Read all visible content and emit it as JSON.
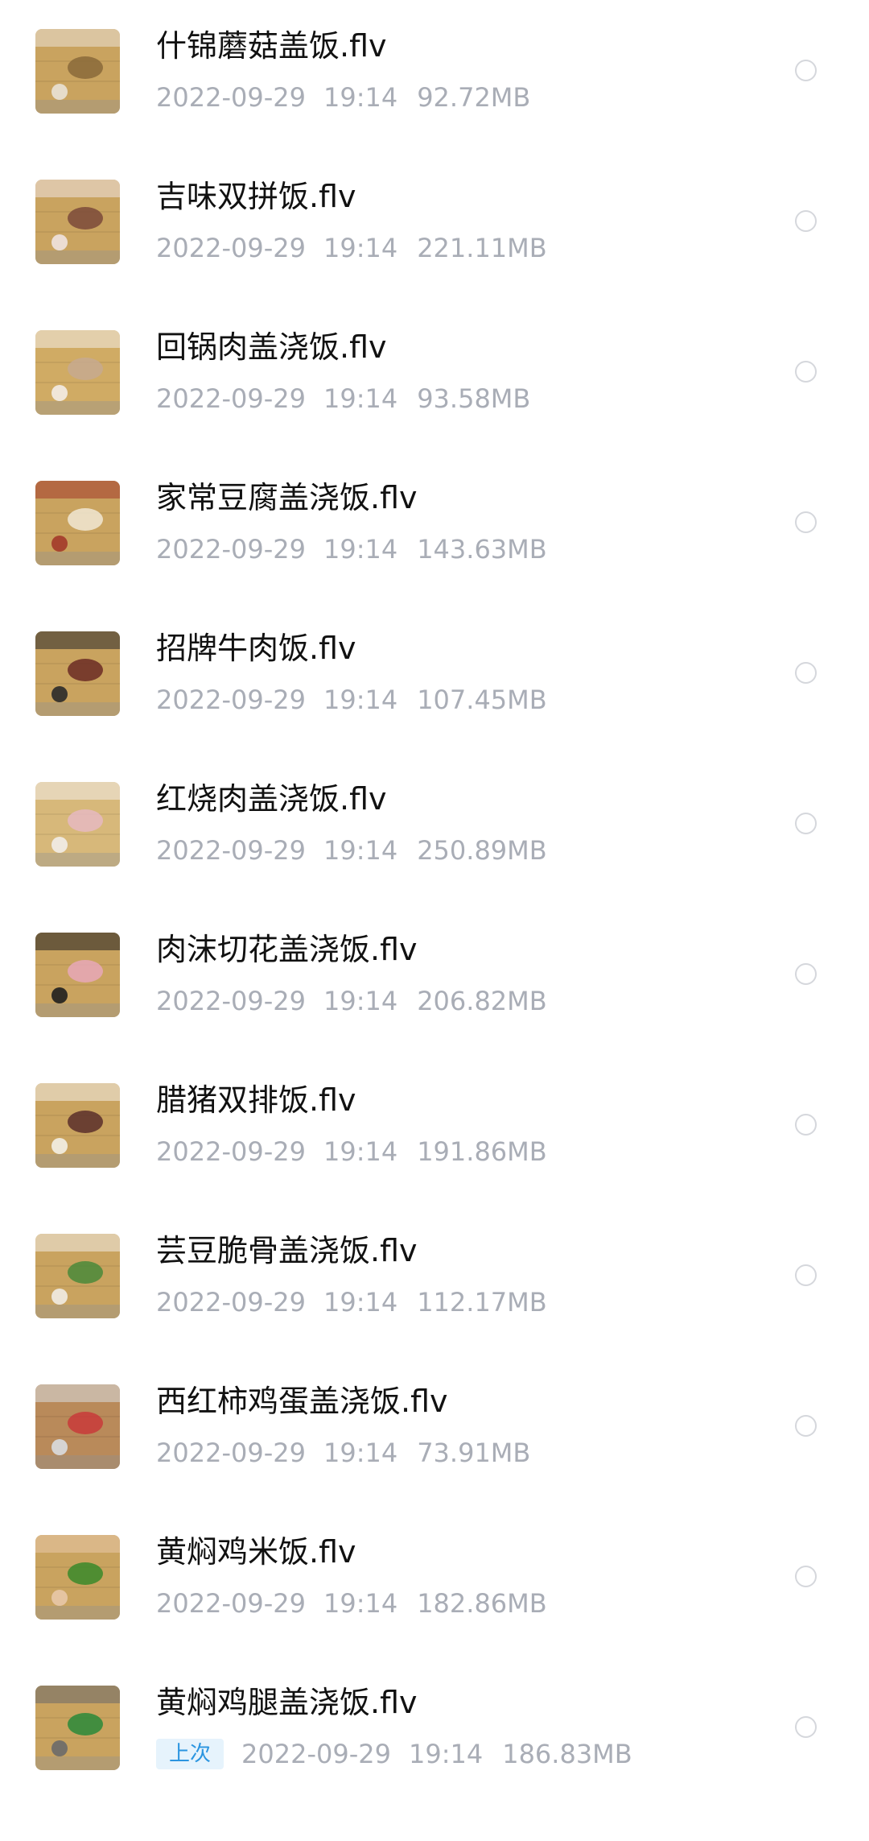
{
  "files": [
    {
      "name": "什锦蘑菇盖饭.flv",
      "date": "2022-09-29",
      "time": "19:14",
      "size": "92.72MB",
      "thumb_icon": "video-thumbnail-icon",
      "thumb_colors": [
        "#c9a35f",
        "#8a6a3a",
        "#e9e2d6"
      ]
    },
    {
      "name": "吉味双拼饭.flv",
      "date": "2022-09-29",
      "time": "19:14",
      "size": "221.11MB",
      "thumb_icon": "video-thumbnail-icon",
      "thumb_colors": [
        "#c9a35f",
        "#7b4a3a",
        "#efe3e0"
      ]
    },
    {
      "name": "回锅肉盖浇饭.flv",
      "date": "2022-09-29",
      "time": "19:14",
      "size": "93.58MB",
      "thumb_icon": "video-thumbnail-icon",
      "thumb_colors": [
        "#d0ab64",
        "#c7a98f",
        "#f3ece6"
      ]
    },
    {
      "name": "家常豆腐盖浇饭.flv",
      "date": "2022-09-29",
      "time": "19:14",
      "size": "143.63MB",
      "thumb_icon": "video-thumbnail-icon",
      "thumb_colors": [
        "#c9a35f",
        "#f1e8d4",
        "#a33a2a"
      ]
    },
    {
      "name": "招牌牛肉饭.flv",
      "date": "2022-09-29",
      "time": "19:14",
      "size": "107.45MB",
      "thumb_icon": "video-thumbnail-icon",
      "thumb_colors": [
        "#c9a35f",
        "#6b2b24",
        "#2a2a2a"
      ]
    },
    {
      "name": "红烧肉盖浇饭.flv",
      "date": "2022-09-29",
      "time": "19:14",
      "size": "250.89MB",
      "thumb_icon": "video-thumbnail-icon",
      "thumb_colors": [
        "#d7b87a",
        "#e6b9c1",
        "#f2ede8"
      ]
    },
    {
      "name": "肉沫切花盖浇饭.flv",
      "date": "2022-09-29",
      "time": "19:14",
      "size": "206.82MB",
      "thumb_icon": "video-thumbnail-icon",
      "thumb_colors": [
        "#c9a35f",
        "#e8a8b8",
        "#1f1f1f"
      ]
    },
    {
      "name": "腊猪双排饭.flv",
      "date": "2022-09-29",
      "time": "19:14",
      "size": "191.86MB",
      "thumb_icon": "video-thumbnail-icon",
      "thumb_colors": [
        "#c9a35f",
        "#5a2f2a",
        "#f3efe6"
      ]
    },
    {
      "name": "芸豆脆骨盖浇饭.flv",
      "date": "2022-09-29",
      "time": "19:14",
      "size": "112.17MB",
      "thumb_icon": "video-thumbnail-icon",
      "thumb_colors": [
        "#c9a35f",
        "#4a8a3a",
        "#f1ece4"
      ]
    },
    {
      "name": "西红柿鸡蛋盖浇饭.flv",
      "date": "2022-09-29",
      "time": "19:14",
      "size": "73.91MB",
      "thumb_icon": "video-thumbnail-icon",
      "thumb_colors": [
        "#b98a5a",
        "#c83a3a",
        "#d9dce0"
      ]
    },
    {
      "name": "黄焖鸡米饭.flv",
      "date": "2022-09-29",
      "time": "19:14",
      "size": "182.86MB",
      "thumb_icon": "video-thumbnail-icon",
      "thumb_colors": [
        "#c9a35f",
        "#3a8a2a",
        "#e8c8a8"
      ]
    },
    {
      "name": "黄焖鸡腿盖浇饭.flv",
      "date": "2022-09-29",
      "time": "19:14",
      "size": "186.83MB",
      "badge": "上次",
      "thumb_icon": "video-thumbnail-icon",
      "thumb_colors": [
        "#c9a35f",
        "#2a8a3a",
        "#6a6a6a"
      ]
    }
  ],
  "colors": {
    "title": "#111111",
    "meta": "#a9adb6",
    "radio_border": "#d5d7dc",
    "badge_text": "#2b95e0",
    "badge_bg": "#e6f3fc"
  }
}
